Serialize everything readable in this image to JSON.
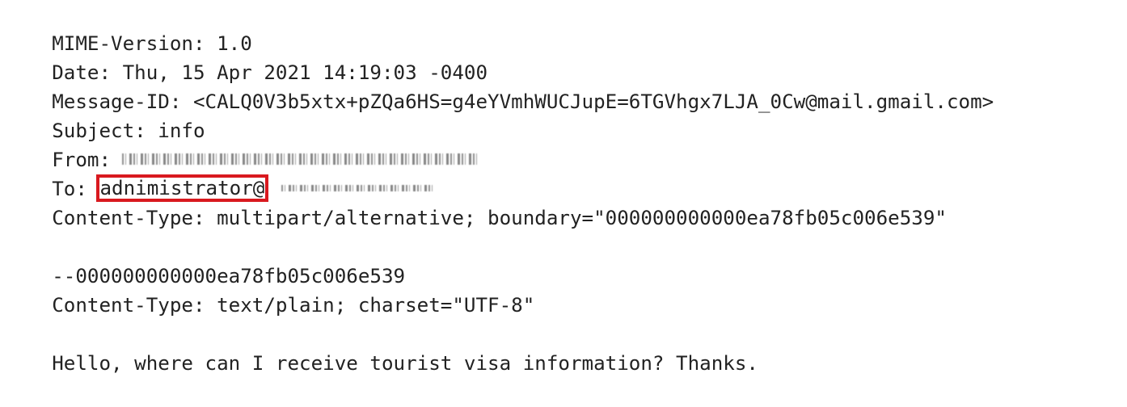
{
  "headers": {
    "mime_version": "MIME-Version: 1.0",
    "date": "Date: Thu, 15 Apr 2021 14:19:03 -0400",
    "message_id": "Message-ID: <CALQ0V3b5xtx+pZQa6HS=g4eYVmhWUCJupE=6TGVhgx7LJA_0Cw@mail.gmail.com>",
    "subject": "Subject: info",
    "from_label": "From:",
    "to_label": "To: ",
    "to_highlighted": "adnimistrator@",
    "content_type": "Content-Type: multipart/alternative; boundary=\"000000000000ea78fb05c006e539\""
  },
  "part": {
    "boundary": "--000000000000ea78fb05c006e539",
    "content_type": "Content-Type: text/plain; charset=\"UTF-8\""
  },
  "body": {
    "text": "Hello, where can I receive tourist visa information? Thanks."
  },
  "colors": {
    "highlight_border": "#d9191f",
    "text": "#222222",
    "background": "#ffffff"
  }
}
